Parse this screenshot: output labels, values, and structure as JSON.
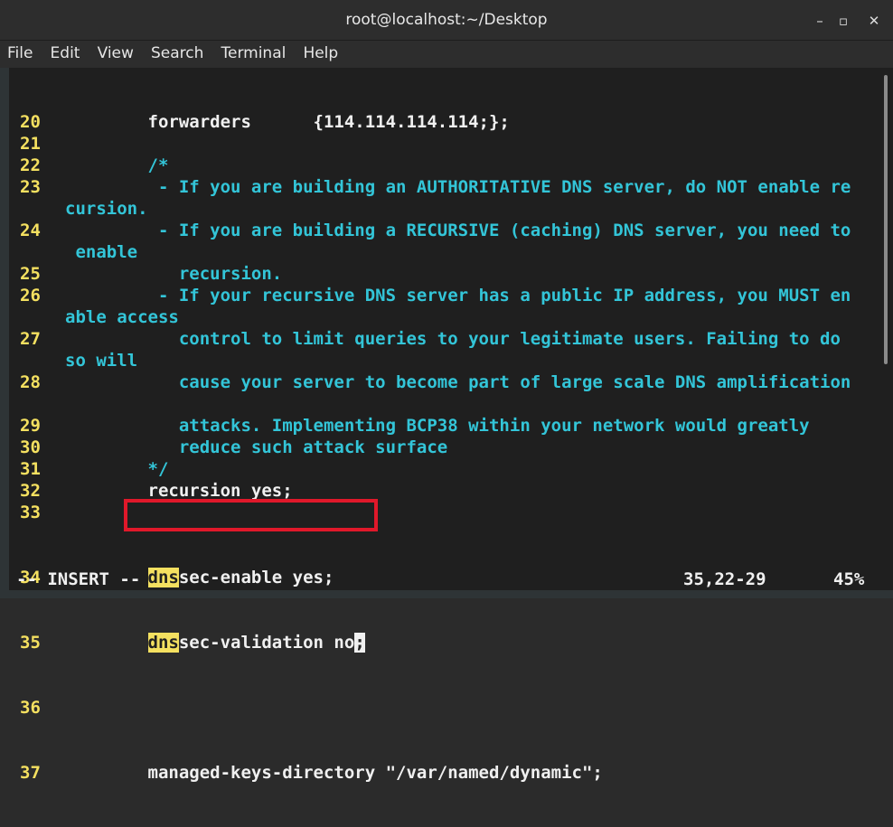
{
  "window": {
    "title": "root@localhost:~/Desktop",
    "minimize_glyph": "–",
    "maximize_glyph": "▫",
    "close_glyph": "✕"
  },
  "menu": [
    "File",
    "Edit",
    "View",
    "Search",
    "Terminal",
    "Help"
  ],
  "lines": [
    {
      "n": "20",
      "t": "        forwarders      {114.114.114.114;};",
      "style": "white"
    },
    {
      "n": "21",
      "t": "",
      "style": "white"
    },
    {
      "n": "22",
      "t": "        /*",
      "style": "comment"
    },
    {
      "n": "23",
      "t": "         - If you are building an AUTHORITATIVE DNS server, do NOT enable re",
      "style": "comment"
    },
    {
      "n": "",
      "t": "cursion.",
      "style": "comment"
    },
    {
      "n": "24",
      "t": "         - If you are building a RECURSIVE (caching) DNS server, you need to",
      "style": "comment"
    },
    {
      "n": "",
      "t": " enable",
      "style": "comment"
    },
    {
      "n": "25",
      "t": "           recursion.",
      "style": "comment"
    },
    {
      "n": "26",
      "t": "         - If your recursive DNS server has a public IP address, you MUST en",
      "style": "comment"
    },
    {
      "n": "",
      "t": "able access",
      "style": "comment"
    },
    {
      "n": "27",
      "t": "           control to limit queries to your legitimate users. Failing to do",
      "style": "comment"
    },
    {
      "n": "",
      "t": "so will",
      "style": "comment"
    },
    {
      "n": "28",
      "t": "           cause your server to become part of large scale DNS amplification",
      "style": "comment"
    },
    {
      "n": "",
      "t": "",
      "style": "comment"
    },
    {
      "n": "29",
      "t": "           attacks. Implementing BCP38 within your network would greatly",
      "style": "comment"
    },
    {
      "n": "30",
      "t": "           reduce such attack surface",
      "style": "comment"
    },
    {
      "n": "31",
      "t": "        */",
      "style": "comment"
    },
    {
      "n": "32",
      "t": "        recursion yes;",
      "style": "white"
    },
    {
      "n": "33",
      "t": "",
      "style": "white"
    }
  ],
  "line34": {
    "n": "34",
    "indent": "        ",
    "hl": "dns",
    "rest": "sec-enable yes;"
  },
  "line35": {
    "n": "35",
    "indent": "        ",
    "hl": "dns",
    "rest": "sec-validation no",
    "cursor": ";"
  },
  "line36": {
    "n": "36",
    "t": ""
  },
  "line37": {
    "n": "37",
    "t": "        managed-keys-directory \"/var/named/dynamic\";"
  },
  "status": {
    "mode": "-- INSERT --",
    "position": "35,22-29",
    "percent": "45%"
  },
  "colors": {
    "line_number": "#f4e060",
    "comment": "#33c5d8",
    "highlight": "#f4e060",
    "annotation_box": "#e0182a"
  }
}
